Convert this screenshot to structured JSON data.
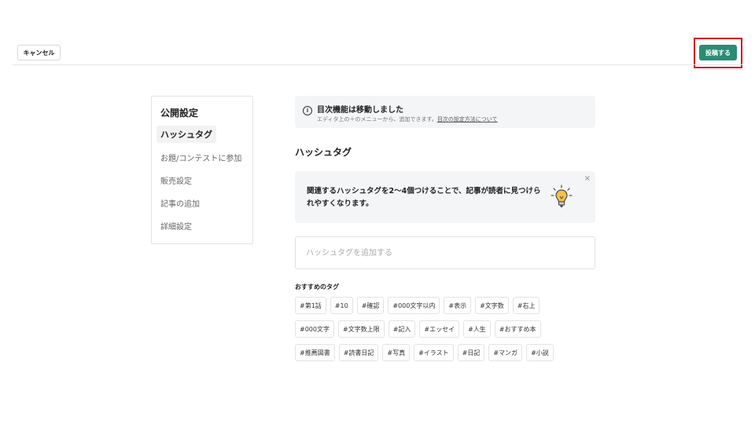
{
  "header": {
    "cancel_label": "キャンセル",
    "post_label": "投稿する",
    "accent_color": "#2a8c74",
    "highlight_color": "#d0021b"
  },
  "sidebar": {
    "title": "公開設定",
    "items": [
      {
        "label": "ハッシュタグ",
        "active": true
      },
      {
        "label": "お題/コンテストに参加",
        "active": false
      },
      {
        "label": "販売設定",
        "active": false
      },
      {
        "label": "記事の追加",
        "active": false
      },
      {
        "label": "詳細設定",
        "active": false
      }
    ]
  },
  "notice": {
    "icon": "info-icon",
    "title": "目次機能は移動しました",
    "subtitle": "エディタ上の＋のメニューから、追加できます。",
    "link": "目次の設定方法について"
  },
  "hashtag": {
    "section_title": "ハッシュタグ",
    "tip_text": "関連するハッシュタグを2〜4個つけることで、記事が読者に見つけられやすくなります。",
    "tip_close": "×",
    "input_placeholder": "ハッシュタグを追加する",
    "recommended_title": "おすすめのタグ",
    "rows": [
      [
        "#第1話",
        "#10",
        "#確認",
        "#000文字以内",
        "#表示",
        "#文字数",
        "#右上"
      ],
      [
        "#000文字",
        "#文字数上限",
        "#記入",
        "#エッセイ",
        "#人生",
        "#おすすめ本"
      ],
      [
        "#推薦図書",
        "#読書日記",
        "#写真",
        "#イラスト",
        "#日記",
        "#マンガ",
        "#小説"
      ]
    ]
  }
}
